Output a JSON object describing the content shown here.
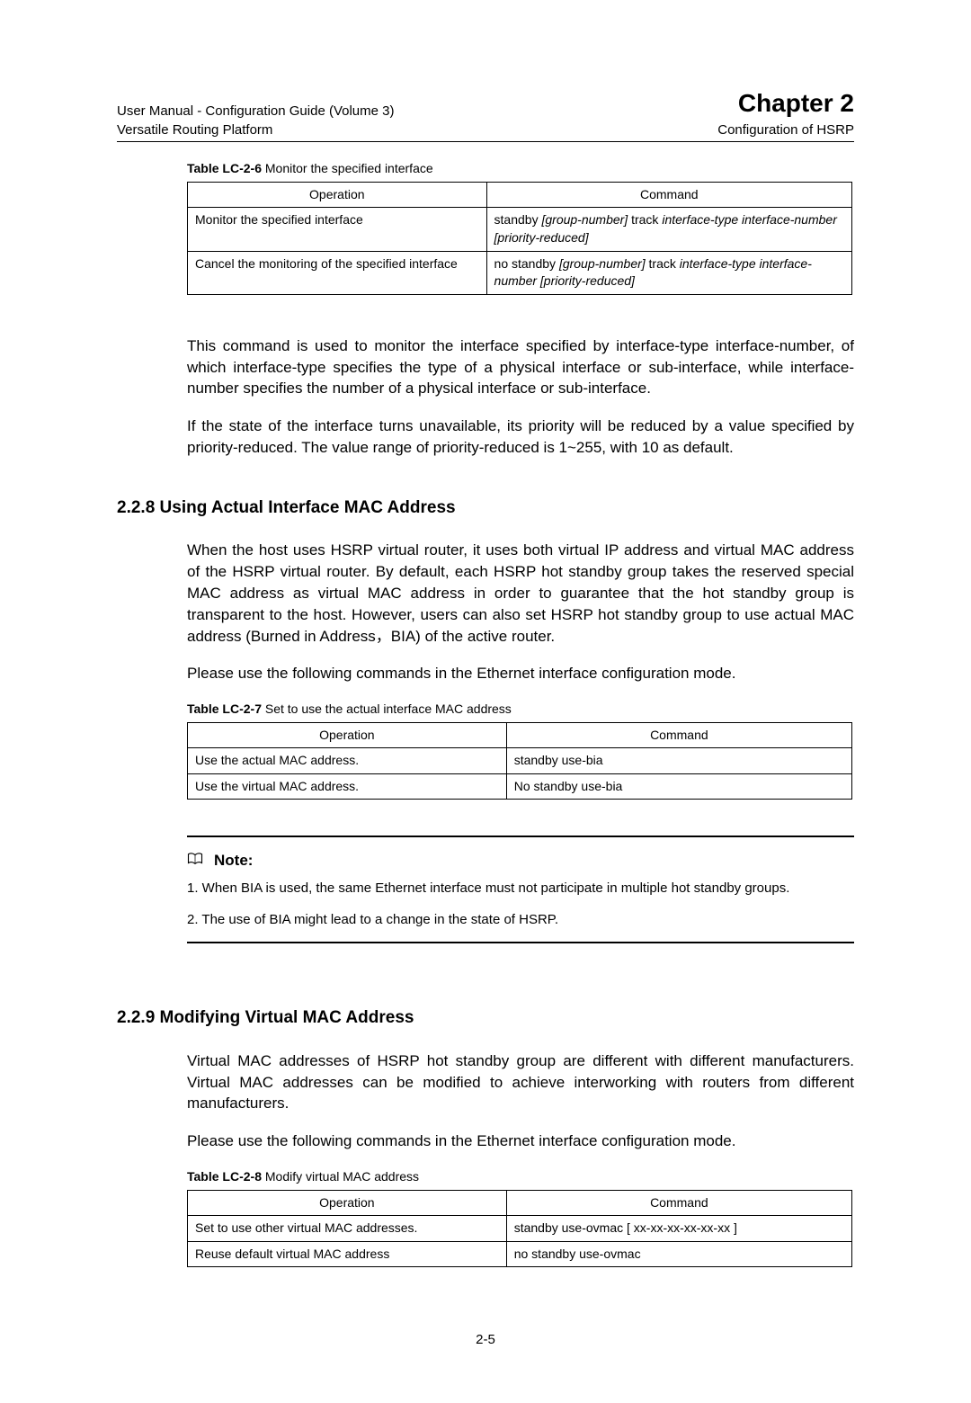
{
  "header": {
    "left1": "User Manual - Configuration Guide (Volume 3)",
    "left2": "Versatile Routing Platform",
    "right1": "Chapter 2",
    "right2": "Configuration of HSRP"
  },
  "t6": {
    "caption_prefix": "Table LC-2-6",
    "caption_text": "Monitor the specified interface",
    "h_op": "Operation",
    "h_cmd": "Command",
    "r1_op": "Monitor the specified interface",
    "r1_cmd_a": "standby ",
    "r1_cmd_b": "[group-number] ",
    "r1_cmd_c": "track ",
    "r1_cmd_d": "interface-type interface-number ",
    "r1_cmd_e": "[priority-reduced]",
    "r2_op": "Cancel the monitoring of the specified interface",
    "r2_cmd_a": "no standby ",
    "r2_cmd_b": "[group-number] ",
    "r2_cmd_c": "track ",
    "r2_cmd_d": "interface-type interface-number ",
    "r2_cmd_e": "[priority-reduced]"
  },
  "p1": "This command is used to monitor the interface specified by interface-type interface-number, of which interface-type specifies the type of a physical interface or sub-interface, while interface-number specifies the number of a physical interface or sub-interface.",
  "p2": "If the state of the interface turns unavailable, its priority will be reduced by a value specified by priority-reduced. The value range of priority-reduced is 1~255, with 10 as default.",
  "s228": {
    "heading": "2.2.8  Using Actual Interface MAC Address",
    "p1": "When the host uses HSRP virtual router, it uses both virtual IP address and virtual MAC address of the HSRP virtual router. By default, each HSRP hot standby group takes the reserved special MAC address as virtual MAC address in order to guarantee that the hot standby group is transparent to the host. However, users can also set HSRP hot standby group to use actual MAC address (Burned in Address，BIA) of the active router.",
    "p2": "Please use the following commands in the Ethernet interface configuration mode."
  },
  "t7": {
    "caption_prefix": "Table LC-2-7",
    "caption_text": "Set to use the actual interface MAC address",
    "h_op": "Operation",
    "h_cmd": "Command",
    "r1_op": "Use the actual MAC address.",
    "r1_cmd": "standby use-bia",
    "r2_op": "Use the virtual MAC address.",
    "r2_cmd": "No standby use-bia"
  },
  "note": {
    "title": "Note:",
    "l1": "1. When BIA is used, the same Ethernet interface must not participate in multiple hot standby groups.",
    "l2": "2. The use of BIA might lead to a change in the state of HSRP."
  },
  "s229": {
    "heading": "2.2.9  Modifying Virtual MAC Address",
    "p1": "Virtual MAC addresses of HSRP hot standby group are different with different manufacturers. Virtual MAC addresses can be modified to achieve interworking with routers from different manufacturers.",
    "p2": "Please use the following commands in the Ethernet interface configuration mode."
  },
  "t8": {
    "caption_prefix": "Table LC-2-8",
    "caption_text": "Modify virtual MAC address",
    "h_op": "Operation",
    "h_cmd": "Command",
    "r1_op": "Set to use other virtual MAC addresses.",
    "r1_cmd": "standby use-ovmac [ xx-xx-xx-xx-xx-xx ]",
    "r2_op": "Reuse default virtual MAC address",
    "r2_cmd": "no standby use-ovmac"
  },
  "page_number": "2-5"
}
